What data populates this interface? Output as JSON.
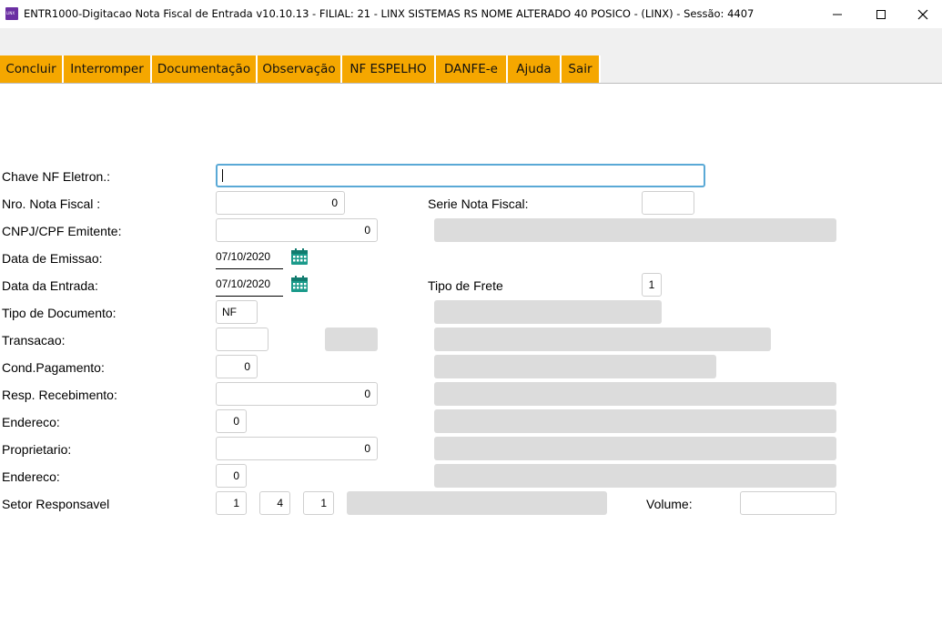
{
  "window": {
    "title": "ENTR1000-Digitacao Nota Fiscal de Entrada v10.10.13   - FILIAL: 21 - LINX SISTEMAS RS NOME ALTERADO 40 POSICO - (LINX) - Sessão: 4407",
    "icon_text": "LINX",
    "controls": [
      "minimize-icon",
      "maximize-icon",
      "close-icon"
    ]
  },
  "toolbar": {
    "tabs": [
      "Concluir",
      "Interromper",
      "Documentação",
      "Observação",
      "NF ESPELHO",
      "DANFE-e",
      "Ajuda",
      "Sair"
    ],
    "accent_color": "#f5a700"
  },
  "form": {
    "chave_label": "Chave NF Eletron.:",
    "chave_value": "",
    "nro_label": "Nro. Nota Fiscal :",
    "nro_value": "0",
    "serie_label": "Serie Nota Fiscal:",
    "serie_value": "",
    "cnpj_label": "CNPJ/CPF Emitente:",
    "cnpj_value": "0",
    "emissao_label": "Data de Emissao:",
    "emissao_value": "07/10/2020",
    "entrada_label": "Data da Entrada:",
    "entrada_value": "07/10/2020",
    "frete_label": "Tipo de Frete",
    "frete_value": "1",
    "tipo_doc_label": "Tipo de Documento:",
    "tipo_doc_value": "NF",
    "transacao_label": "Transacao:",
    "transacao_value": "",
    "cond_label": "Cond.Pagamento:",
    "cond_value": "0",
    "resp_label": "Resp. Recebimento:",
    "resp_value": "0",
    "endereco1_label": "Endereco:",
    "endereco1_value": "0",
    "proprietario_label": "Proprietario:",
    "proprietario_value": "0",
    "endereco2_label": "Endereco:",
    "endereco2_value": "0",
    "setor_label": "Setor Responsavel",
    "setor_values": [
      "1",
      "4",
      "1"
    ],
    "volume_label": "Volume:",
    "volume_value": "",
    "calendar_icon": "calendar-icon"
  }
}
